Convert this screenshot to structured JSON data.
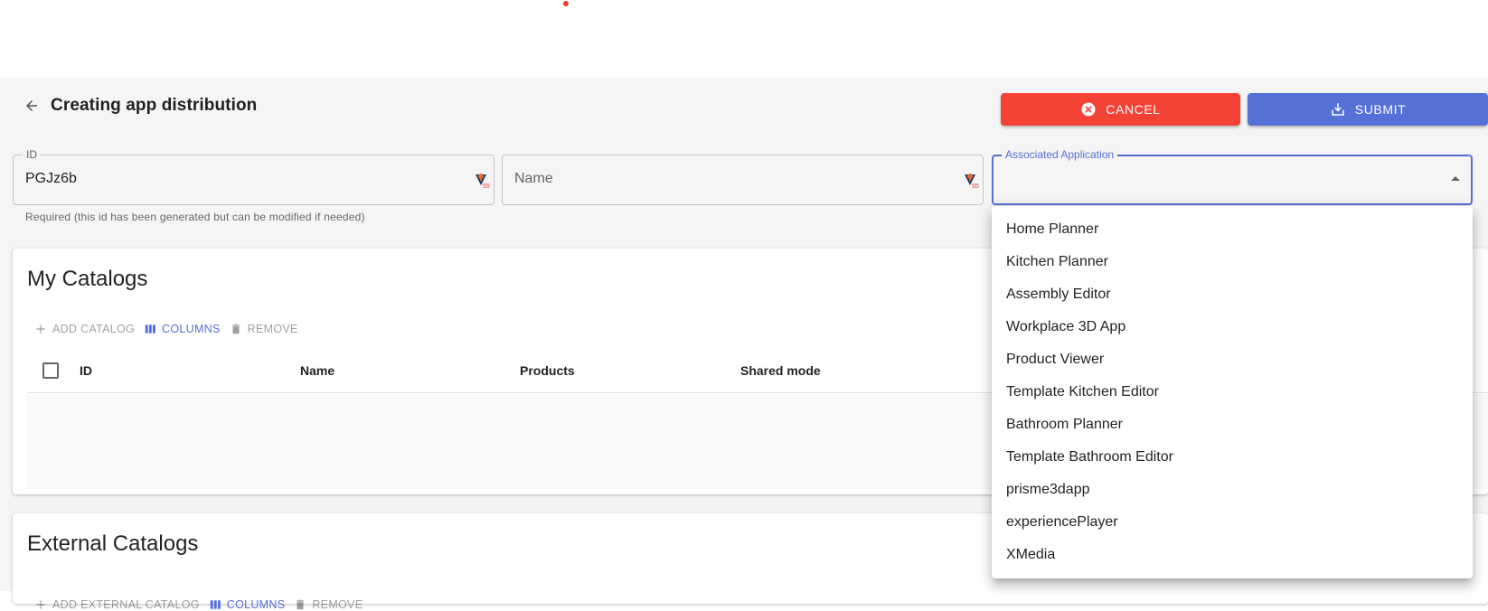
{
  "header": {
    "title": "Creating app distribution",
    "back_icon": "arrow-left-icon"
  },
  "actions": {
    "cancel_label": "CANCEL",
    "cancel_icon": "close-circle-icon",
    "submit_label": "SUBMIT",
    "submit_icon": "download-icon",
    "cancel_color": "#f44336",
    "submit_color": "#5570d6"
  },
  "form": {
    "id": {
      "label": "ID",
      "value": "PGJz6b",
      "helper": "Required (this id has been generated but can be modified if needed)"
    },
    "name": {
      "placeholder": "Name",
      "value": ""
    },
    "associated_application": {
      "label": "Associated Application",
      "value": "",
      "options": [
        "Home Planner",
        "Kitchen Planner",
        "Assembly Editor",
        "Workplace 3D App",
        "Product Viewer",
        "Template Kitchen Editor",
        "Bathroom Planner",
        "Template Bathroom Editor",
        "prisme3dapp",
        "experiencePlayer",
        "XMedia"
      ]
    }
  },
  "my_catalogs": {
    "title": "My Catalogs",
    "toolbar": {
      "add_label": "ADD CATALOG",
      "columns_label": "COLUMNS",
      "remove_label": "REMOVE"
    },
    "columns": [
      "ID",
      "Name",
      "Products",
      "Shared mode"
    ]
  },
  "external_catalogs": {
    "title": "External Catalogs",
    "toolbar": {
      "add_label": "ADD EXTERNAL CATALOG",
      "columns_label": "COLUMNS",
      "remove_label": "REMOVE"
    }
  }
}
